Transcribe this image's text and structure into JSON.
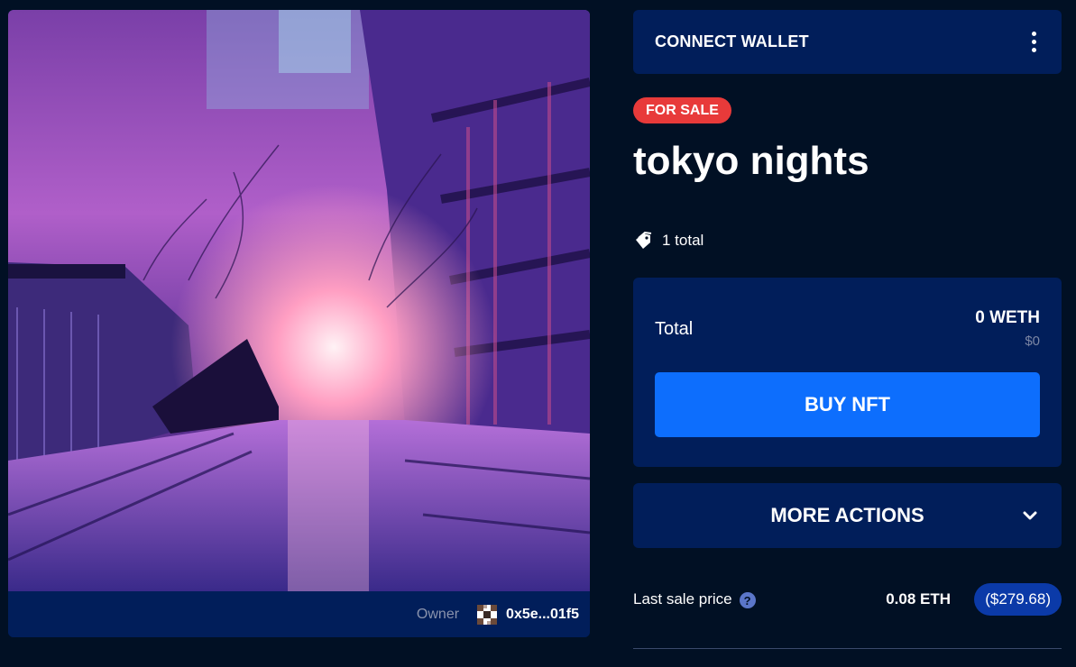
{
  "header": {
    "connect_label": "CONNECT WALLET"
  },
  "nft": {
    "status_badge": "FOR SALE",
    "title": "tokyo nights",
    "total_count": "1 total",
    "owner_label": "Owner",
    "owner_address": "0x5e...01f5"
  },
  "pricing": {
    "total_label": "Total",
    "total_value": "0 WETH",
    "total_usd": "$0",
    "buy_label": "BUY NFT"
  },
  "actions": {
    "more_label": "MORE ACTIONS"
  },
  "last_sale": {
    "label": "Last sale price",
    "help_icon_glyph": "?",
    "eth": "0.08 ETH",
    "usd": "($279.68)"
  },
  "colors": {
    "background": "#011024",
    "panel": "#011e5a",
    "accent_blue": "#0d6efd",
    "sale_red": "#e83a3a",
    "usd_pill": "#0b3aa8"
  },
  "icons": [
    "kebab-menu-icon",
    "tag-icon",
    "chevron-down-icon",
    "help-icon",
    "owner-avatar-icon"
  ]
}
